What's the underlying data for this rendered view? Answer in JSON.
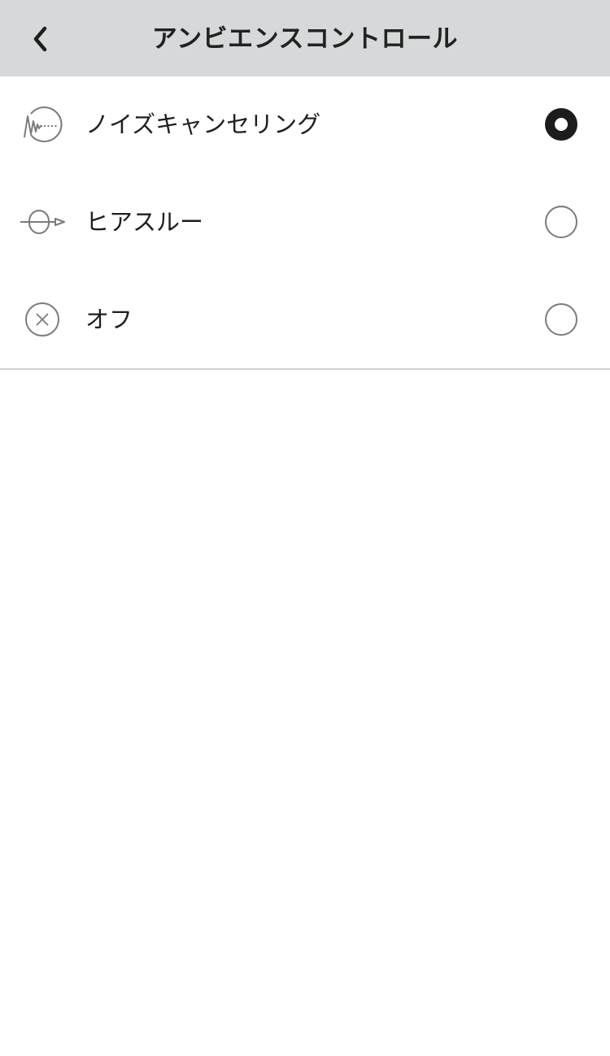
{
  "header": {
    "title": "アンビエンスコントロール",
    "back_icon": "chevron-left-icon",
    "background": "#d5d9d9"
  },
  "options": [
    {
      "label": "ノイズキャンセリング",
      "icon": "noise-cancelling-icon",
      "selected": true
    },
    {
      "label": "ヒアスルー",
      "icon": "hear-through-icon",
      "selected": false
    },
    {
      "label": "オフ",
      "icon": "off-x-circle-icon",
      "selected": false
    }
  ]
}
